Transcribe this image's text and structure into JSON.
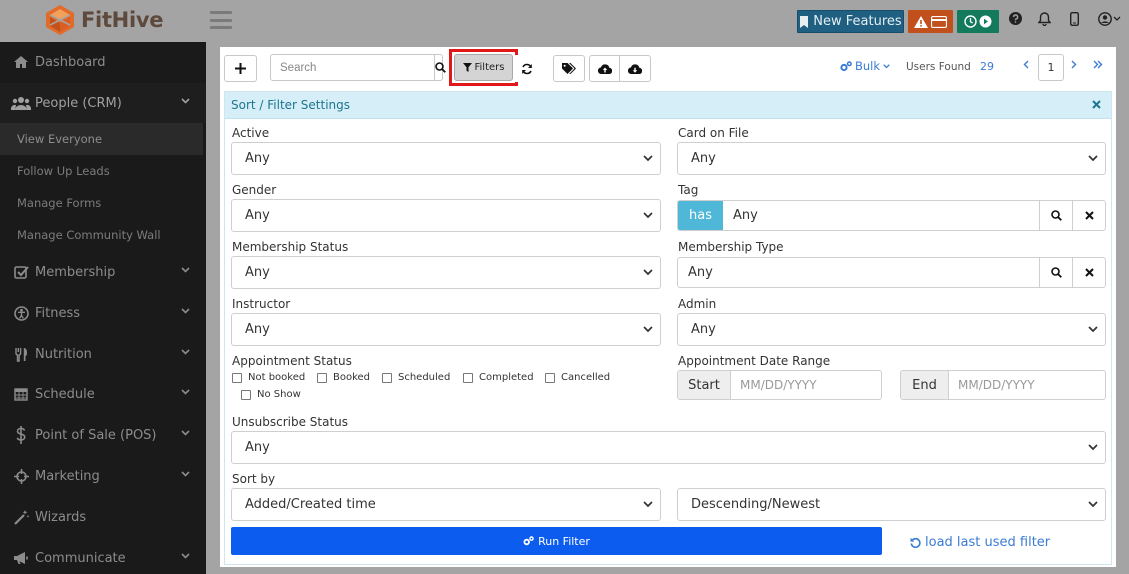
{
  "app": {
    "name": "FitHive",
    "brand_color": "#5e4a3c"
  },
  "header": {
    "new_features_label": "New Features",
    "new_features_color": "#1f5f82",
    "alert_color": "#c2501d",
    "timer_color": "#137a5c",
    "icons": [
      "hamburger-icon",
      "bookmark-icon",
      "warning-icon",
      "credit-card-icon",
      "clock-icon",
      "play-icon",
      "help-icon",
      "bell-icon",
      "mobile-icon",
      "user-icon"
    ]
  },
  "sidebar": {
    "items": [
      {
        "label": "Dashboard",
        "icon": "dashboard-icon"
      },
      {
        "label": "People (CRM)",
        "icon": "people-icon",
        "active": true
      },
      {
        "label": "Membership",
        "icon": "check-icon"
      },
      {
        "label": "Fitness",
        "icon": "fitness-icon"
      },
      {
        "label": "Nutrition",
        "icon": "nutrition-icon"
      },
      {
        "label": "Schedule",
        "icon": "calendar-icon"
      },
      {
        "label": "Point of Sale (POS)",
        "icon": "dollar-icon"
      },
      {
        "label": "Marketing",
        "icon": "crosshair-icon"
      },
      {
        "label": "Wizards",
        "icon": "wand-icon"
      },
      {
        "label": "Communicate",
        "icon": "megaphone-icon"
      }
    ],
    "sub_items": [
      {
        "label": "View Everyone",
        "active": true
      },
      {
        "label": "Follow Up Leads"
      },
      {
        "label": "Manage Forms"
      },
      {
        "label": "Manage Community Wall"
      }
    ]
  },
  "toolbar": {
    "search_placeholder": "Search",
    "filters_label": "Filters",
    "bulk_label": "Bulk",
    "users_found_label": "Users Found",
    "users_found_count": "29",
    "page_number": "1"
  },
  "filter": {
    "title": "Sort / Filter Settings",
    "active": {
      "label": "Active",
      "value": "Any"
    },
    "card_on_file": {
      "label": "Card on File",
      "value": "Any"
    },
    "gender": {
      "label": "Gender",
      "value": "Any"
    },
    "tag": {
      "label": "Tag",
      "mode": "has",
      "value": "Any"
    },
    "membership_status": {
      "label": "Membership Status",
      "value": "Any"
    },
    "membership_type": {
      "label": "Membership Type",
      "value": "Any"
    },
    "instructor": {
      "label": "Instructor",
      "value": "Any"
    },
    "admin": {
      "label": "Admin",
      "value": "Any"
    },
    "appointment_status": {
      "label": "Appointment Status",
      "options": [
        "Not booked",
        "Booked",
        "Scheduled",
        "Completed",
        "Cancelled",
        "No Show"
      ]
    },
    "appointment_date_range": {
      "label": "Appointment Date Range",
      "start_label": "Start",
      "end_label": "End",
      "start_placeholder": "MM/DD/YYYY",
      "end_placeholder": "MM/DD/YYYY"
    },
    "unsubscribe_status": {
      "label": "Unsubscribe Status",
      "value": "Any"
    },
    "sort_by": {
      "label": "Sort by",
      "field": "Added/Created time",
      "order": "Descending/Newest"
    },
    "run_filter_label": "Run Filter",
    "load_last_label": "load last used filter",
    "run_color": "#0d5cf0"
  }
}
